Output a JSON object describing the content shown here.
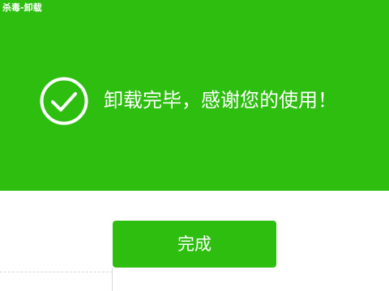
{
  "window": {
    "title": "杀毒-卸载"
  },
  "icons": {
    "success": "check-circle-icon"
  },
  "main": {
    "message": "卸载完毕，感谢您的使用！"
  },
  "actions": {
    "done_label": "完成"
  },
  "colors": {
    "accent": "#2dbe0f",
    "text_on_accent": "#ffffff",
    "background": "#ffffff",
    "divider": "#d9d9d9"
  }
}
